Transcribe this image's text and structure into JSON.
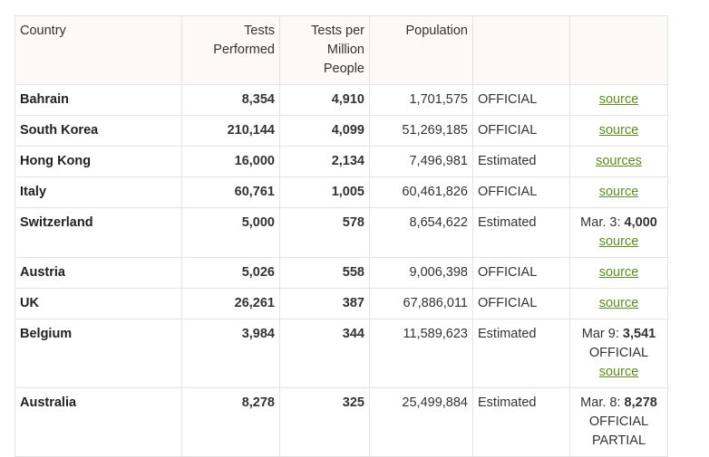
{
  "table": {
    "headers": {
      "country": "Country",
      "tests": "Tests Performed",
      "per_million": "Tests per Million People",
      "population": "Population",
      "status": "",
      "source": ""
    },
    "rows": [
      {
        "country": "Bahrain",
        "tests": "8,354",
        "per_million": "4,910",
        "population": "1,701,575",
        "status": "OFFICIAL",
        "src_prefix": "",
        "src_bold": "",
        "src_extra": "",
        "src_link": "source"
      },
      {
        "country": "South Korea",
        "tests": "210,144",
        "per_million": "4,099",
        "population": "51,269,185",
        "status": "OFFICIAL",
        "src_prefix": "",
        "src_bold": "",
        "src_extra": "",
        "src_link": "source"
      },
      {
        "country": "Hong Kong",
        "tests": "16,000",
        "per_million": "2,134",
        "population": "7,496,981",
        "status": "Estimated",
        "src_prefix": "",
        "src_bold": "",
        "src_extra": "",
        "src_link": "sources"
      },
      {
        "country": "Italy",
        "tests": "60,761",
        "per_million": "1,005",
        "population": "60,461,826",
        "status": "OFFICIAL",
        "src_prefix": "",
        "src_bold": "",
        "src_extra": "",
        "src_link": "source"
      },
      {
        "country": "Switzerland",
        "tests": "5,000",
        "per_million": "578",
        "population": "8,654,622",
        "status": "Estimated",
        "src_prefix": "Mar. 3: ",
        "src_bold": "4,000",
        "src_extra": "",
        "src_link": "source"
      },
      {
        "country": "Austria",
        "tests": "5,026",
        "per_million": "558",
        "population": "9,006,398",
        "status": "OFFICIAL",
        "src_prefix": "",
        "src_bold": "",
        "src_extra": "",
        "src_link": "source"
      },
      {
        "country": "UK",
        "tests": "26,261",
        "per_million": "387",
        "population": "67,886,011",
        "status": "OFFICIAL",
        "src_prefix": "",
        "src_bold": "",
        "src_extra": "",
        "src_link": "source"
      },
      {
        "country": "Belgium",
        "tests": "3,984",
        "per_million": "344",
        "population": "11,589,623",
        "status": "Estimated",
        "src_prefix": "Mar 9: ",
        "src_bold": "3,541",
        "src_extra": "OFFICIAL",
        "src_link": "source"
      },
      {
        "country": "Australia",
        "tests": "8,278",
        "per_million": "325",
        "population": "25,499,884",
        "status": "Estimated",
        "src_prefix": "Mar. 8: ",
        "src_bold": "8,278",
        "src_extra": "OFFICIAL PARTIAL",
        "src_link": ""
      }
    ]
  },
  "colors": {
    "link": "#5f8a1e",
    "header_bg": "#fcf9f8",
    "border": "#e3e3e3"
  }
}
